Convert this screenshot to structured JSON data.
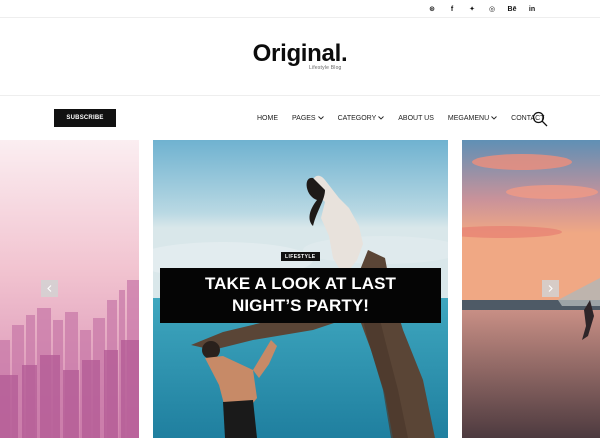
{
  "social": {
    "icons": [
      "pinterest-icon",
      "facebook-icon",
      "twitter-icon",
      "dribbble-icon",
      "behance-icon",
      "linkedin-icon"
    ],
    "glyphs": [
      "⊛",
      "f",
      "✦",
      "◎",
      "Bē",
      "in"
    ]
  },
  "brand": {
    "title": "Original.",
    "tagline": "Lifestyle Blog"
  },
  "nav": {
    "subscribe_label": "SUBSCRIBE",
    "items": [
      {
        "label": "HOME",
        "dropdown": false
      },
      {
        "label": "PAGES",
        "dropdown": true
      },
      {
        "label": "CATEGORY",
        "dropdown": true
      },
      {
        "label": "ABOUT US",
        "dropdown": false
      },
      {
        "label": "MEGAMENU",
        "dropdown": true
      },
      {
        "label": "CONTACT",
        "dropdown": false
      }
    ]
  },
  "featured": {
    "category": "LIFESTYLE",
    "title_line1": "TAKE A LOOK AT LAST",
    "title_line2": "NIGHT’S PARTY!"
  },
  "colors": {
    "accent": "#111111",
    "slide_left_top": "#f3c9d2",
    "slide_left_bottom": "#b8508a",
    "sea": "#2f9bb5",
    "sunset": "#e98a70"
  }
}
